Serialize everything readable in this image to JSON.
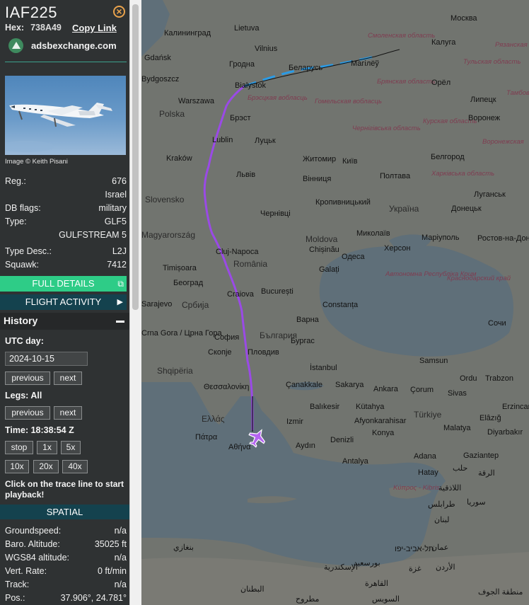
{
  "aircraft": {
    "callsign": "IAF225",
    "hex_label": "Hex:",
    "hex": "738A49",
    "copy_link": "Copy Link",
    "source": "adsbexchange.com",
    "photo_credit": "Image © Keith Pisani",
    "fields": [
      {
        "label": "Reg.:",
        "value": "676"
      },
      {
        "label": "",
        "value": "Israel"
      },
      {
        "label": "DB flags:",
        "value": "military"
      },
      {
        "label": "Type:",
        "value": "GLF5"
      },
      {
        "label": "",
        "value": "GULFSTREAM 5"
      },
      {
        "label": "Type Desc.:",
        "value": "L2J"
      },
      {
        "label": "Squawk:",
        "value": "7412"
      }
    ],
    "full_details": "FULL DETAILS",
    "flight_activity": "FLIGHT ACTIVITY"
  },
  "history": {
    "title": "History",
    "utc_day_label": "UTC day:",
    "date": "2024-10-15",
    "previous": "previous",
    "next": "next",
    "legs_label": "Legs: All",
    "time_label": "Time: 18:38:54 Z",
    "playback_buttons": [
      "stop",
      "1x",
      "5x",
      "10x",
      "20x",
      "40x"
    ],
    "note": "Click on the trace line to start playback!"
  },
  "spatial": {
    "title": "SPATIAL",
    "fields": [
      {
        "label": "Groundspeed:",
        "value": "n/a"
      },
      {
        "label": "Baro. Altitude:",
        "value": "35025 ft"
      },
      {
        "label": "WGS84 altitude:",
        "value": "n/a"
      },
      {
        "label": "Vert. Rate:",
        "value": "0 ft/min"
      },
      {
        "label": "Track:",
        "value": "n/a"
      },
      {
        "label": "Pos.:",
        "value": "37.906°, 24.781°"
      }
    ]
  },
  "map": {
    "cities": [
      "Москва",
      "Калининград",
      "Lietuva",
      "Смоленская область",
      "Калуга",
      "Тульская область",
      "Рязанская область",
      "Vilnius",
      "Gdańsk",
      "Гродна",
      "Беларусь",
      "Магілёў",
      "Bydgoszcz",
      "Białystok",
      "Брэсцкая вобласць",
      "Гомельская вобласць",
      "Брянская область",
      "Орёл",
      "Тамбовская",
      "Липецк",
      "Polska",
      "Warszawa",
      "Брэст",
      "Чернігівська область",
      "Курская область",
      "Воронеж",
      "Lublin",
      "Луцьк",
      "Житомир",
      "Київ",
      "Белгород",
      "Воронежская",
      "Kraków",
      "Львів",
      "Вінниця",
      "Полтава",
      "Харківська область",
      "Slovensko",
      "Чернівці",
      "Кропивницький",
      "Україна",
      "Луганськ",
      "Донецьк",
      "Magyarország",
      "Cluj-Napoca",
      "Moldova",
      "Миколаїв",
      "Маріуполь",
      "Ростов-на-Дону",
      "Chișinău",
      "România",
      "Херсон",
      "Одеса",
      "Timișoara",
      "Galați",
      "Автономна Республіка Крим",
      "Краснодарский край",
      "Београд",
      "Craiova",
      "București",
      "Constanța",
      "Sarajevo",
      "Србија",
      "Сочи",
      "Варна",
      "България",
      "Crna Gora / Црна Гора",
      "София",
      "Бургас",
      "Скопје",
      "Пловдив",
      "Shqipëria",
      "Θεσσαλονίκη",
      "İstanbul",
      "Samsun",
      "Çanakkale",
      "Sakarya",
      "Ankara",
      "Çorum",
      "Ordu",
      "Trabzon",
      "Sivas",
      "Ελλάς",
      "Balıkesir",
      "Kütahya",
      "Türkiye",
      "Erzincan",
      "Izmir",
      "Afyonkarahisar",
      "Elâzığ",
      "Πάτρα",
      "Αθήνα",
      "Aydın",
      "Denizli",
      "Konya",
      "Malatya",
      "Diyarbakır",
      "Gaziantep",
      "Antalya",
      "Adana",
      "Hatay",
      "حلب",
      "الرقة",
      "Κύπρος - Kibris",
      "اللاذقية",
      "سوريا",
      "طرابلس",
      "لبنان",
      "بنغازي",
      "תל-אביב-יפו",
      "عمان",
      "بورسعيد",
      "الإسكندرية",
      "الأردن",
      "غزة",
      "القاهرة",
      "البطنان",
      "مطروح",
      "منطقة الجوف",
      "السويس"
    ]
  }
}
